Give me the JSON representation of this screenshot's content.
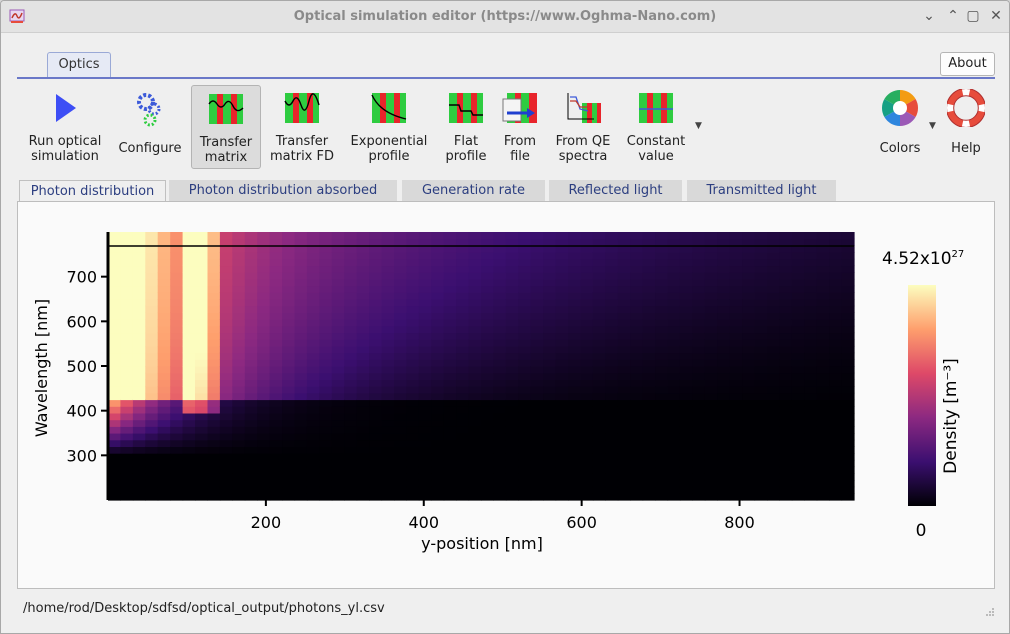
{
  "window": {
    "title": "Optical simulation editor (https://www.Oghma-Nano.com)"
  },
  "ribbon": {
    "tab": "Optics",
    "about": "About"
  },
  "toolbar": [
    {
      "line1": "Run optical",
      "line2": "simulation",
      "icon": "play-icon"
    },
    {
      "line1": "Configure",
      "line2": "",
      "icon": "gears-icon"
    },
    {
      "line1": "Transfer",
      "line2": "matrix",
      "icon": "transfer-matrix-icon"
    },
    {
      "line1": "Transfer",
      "line2": "matrix FD",
      "icon": "transfer-matrix-fd-icon"
    },
    {
      "line1": "Exponential",
      "line2": "profile",
      "icon": "exponential-profile-icon"
    },
    {
      "line1": "Flat",
      "line2": "profile",
      "icon": "flat-profile-icon"
    },
    {
      "line1": "From",
      "line2": "file",
      "icon": "from-file-icon"
    },
    {
      "line1": "From QE",
      "line2": "spectra",
      "icon": "qe-spectra-icon"
    },
    {
      "line1": "Constant",
      "line2": "value",
      "icon": "constant-value-icon"
    },
    {
      "line1": "Colors",
      "line2": "",
      "icon": "color-wheel-icon"
    },
    {
      "line1": "Help",
      "line2": "",
      "icon": "lifebuoy-icon"
    }
  ],
  "tabs": [
    "Photon distribution",
    "Photon distribution absorbed",
    "Generation rate",
    "Reflected light",
    "Transmitted light"
  ],
  "chart_data": {
    "type": "heatmap",
    "xlabel": "y-position [nm]",
    "ylabel": "Wavelength [nm]",
    "x_ticks": [
      "200",
      "400",
      "600",
      "800"
    ],
    "y_ticks": [
      "300",
      "400",
      "500",
      "600",
      "700"
    ],
    "xlim": [
      0,
      945
    ],
    "ylim": [
      200,
      800
    ],
    "colorbar": {
      "label": "Density [m⁻³]",
      "max": "4.52x10",
      "max_exp": "27",
      "min": "0"
    },
    "colormap": [
      "#000004",
      "#3b0f70",
      "#8c2981",
      "#de4968",
      "#fe9f6d",
      "#fcfdbf"
    ]
  },
  "status": {
    "path": "/home/rod/Desktop/sdfsd/optical_output/photons_yl.csv"
  }
}
